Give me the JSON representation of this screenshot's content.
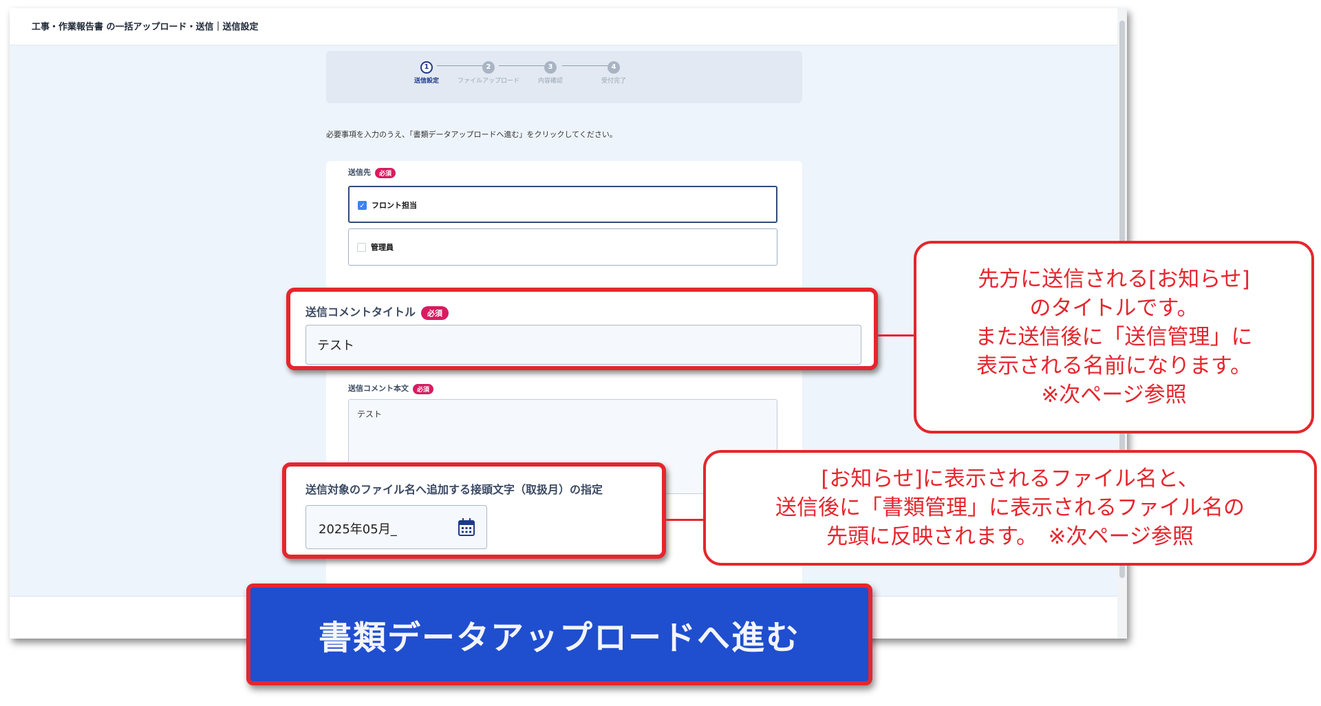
{
  "header": {
    "title": "工事・作業報告書 の一括アップロード・送信｜送信設定"
  },
  "stepper": {
    "steps": [
      {
        "number": "1",
        "label": "送信設定"
      },
      {
        "number": "2",
        "label": "ファイルアップロード"
      },
      {
        "number": "3",
        "label": "内容確認"
      },
      {
        "number": "4",
        "label": "受付完了"
      }
    ]
  },
  "instruction": "必要事項を入力のうえ、「書類データアップロードへ進む」をクリックしてください。",
  "form": {
    "required_badge": "必須",
    "recipient": {
      "label": "送信先",
      "options": [
        {
          "label": "フロント担当",
          "checked": true
        },
        {
          "label": "管理員",
          "checked": false
        }
      ]
    },
    "comment_title": {
      "label": "送信コメントタイトル",
      "value": "テスト"
    },
    "comment_body": {
      "label": "送信コメント本文",
      "value": "テスト"
    },
    "file_prefix": {
      "label": "送信対象のファイル名へ追加する接頭文字（取扱月）の指定",
      "value": "2025年05月_"
    }
  },
  "upload_button": {
    "label": "書類データアップロードへ進む"
  },
  "notes": {
    "title_note": [
      "先方に送信される[お知らせ]",
      "のタイトルです。",
      "また送信後に「送信管理」に",
      "表示される名前になります。",
      "※次ページ参照"
    ],
    "prefix_note": [
      "[お知らせ]に表示されるファイル名と、",
      "送信後に「書類管理」に表示されるファイル名の",
      "先頭に反映されます。　※次ページ参照"
    ]
  },
  "colors": {
    "accent": "#e5262d",
    "primary": "#1f4ecf",
    "badge": "#d81b60"
  }
}
